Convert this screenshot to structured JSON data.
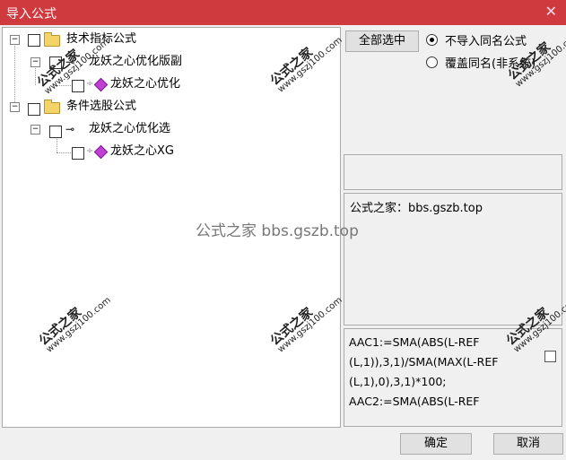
{
  "window": {
    "title": "导入公式",
    "close_glyph": "✕"
  },
  "tree": {
    "nodes": [
      {
        "label": "技术指标公式",
        "icon": "folder-icon"
      },
      {
        "label": "龙妖之心优化版副",
        "icon": "key-icon"
      },
      {
        "label": "龙妖之心优化",
        "icon": "gem-icon"
      },
      {
        "label": "条件选股公式",
        "icon": "folder-icon"
      },
      {
        "label": "龙妖之心优化选",
        "icon": "key-icon"
      },
      {
        "label": "龙妖之心XG",
        "icon": "gem-icon"
      }
    ]
  },
  "options": {
    "select_all_label": "全部选中",
    "radio_skip_label": "不导入同名公式",
    "radio_overwrite_label": "覆盖同名(非系统)",
    "selected": "不导入同名公式"
  },
  "description": "公式之家：bbs.gszb.top",
  "code_lines": [
    "AAC1:=SMA(ABS(L-REF",
    "(L,1)),3,1)/SMA(MAX(L-REF",
    "(L,1),0),3,1)*100;",
    "AAC2:=SMA(ABS(L-REF"
  ],
  "footer": {
    "ok_label": "确定",
    "cancel_label": "取消"
  },
  "watermark": {
    "center_text": "公式之家 bbs.gszb.top",
    "stamp_title": "公式之家",
    "stamp_url": "www.gszj100.com"
  }
}
